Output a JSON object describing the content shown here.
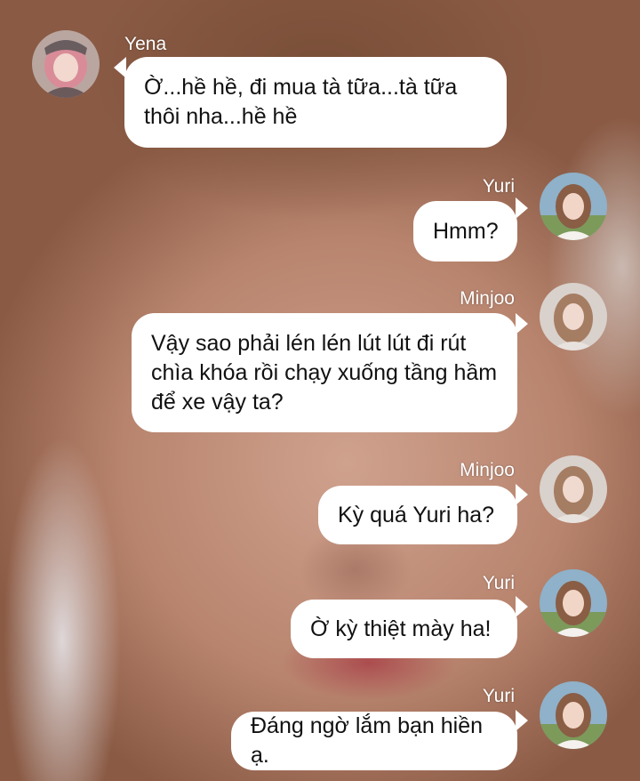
{
  "messages": [
    {
      "sender": "Yena",
      "text": "Ờ...hề hề, đi mua tà tữa...tà tữa thôi nha...hề hề",
      "avatar": "avatar-yena",
      "side": "left"
    },
    {
      "sender": "Yuri",
      "text": "Hmm?",
      "avatar": "avatar-yuri",
      "side": "right"
    },
    {
      "sender": "Minjoo",
      "text": "Vậy sao phải lén lén lút lút đi rút chìa khóa rồi chạy xuống tầng hầm để xe vậy ta?",
      "avatar": "avatar-minjoo",
      "side": "right"
    },
    {
      "sender": "Minjoo",
      "text": "Kỳ quá Yuri ha?",
      "avatar": "avatar-minjoo",
      "side": "right"
    },
    {
      "sender": "Yuri",
      "text": "Ờ kỳ thiệt mày ha!",
      "avatar": "avatar-yuri",
      "side": "right"
    },
    {
      "sender": "Yuri",
      "text": "Đáng ngờ lắm bạn hiền ạ.",
      "avatar": "avatar-yuri",
      "side": "right"
    }
  ],
  "colors": {
    "bubble": "#ffffff",
    "text": "#111111",
    "name": "#ffffff"
  }
}
